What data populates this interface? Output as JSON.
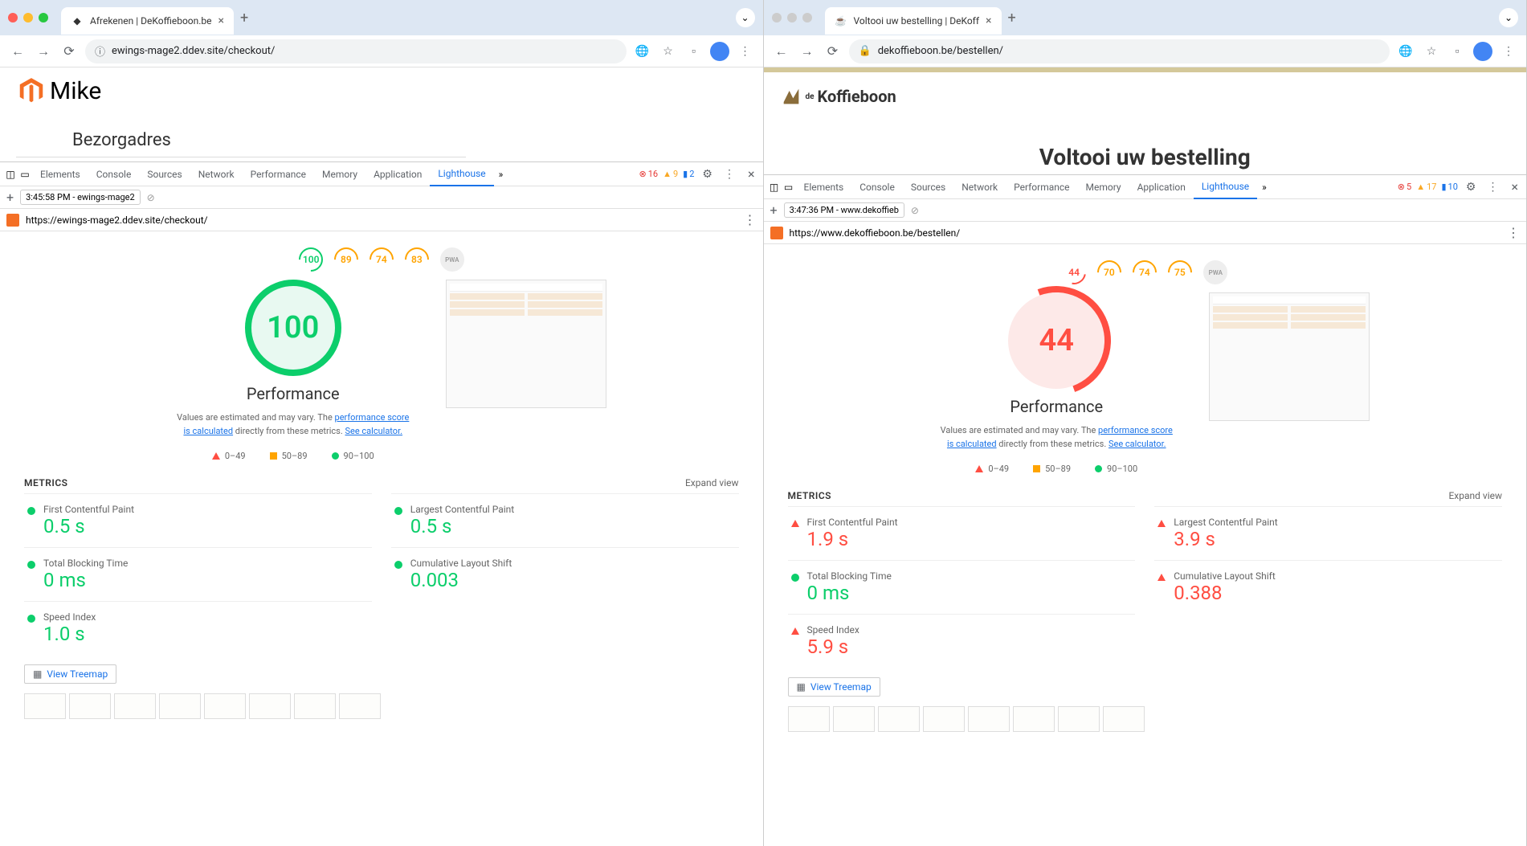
{
  "left": {
    "tab_title": "Afrekenen | DeKoffieboon.be",
    "url": "ewings-mage2.ddev.site/checkout/",
    "logo_text": "Mike",
    "heading": "Bezorgadres",
    "devtools_tabs": [
      "Elements",
      "Console",
      "Sources",
      "Network",
      "Performance",
      "Memory",
      "Application",
      "Lighthouse"
    ],
    "errors": "16",
    "warnings": "9",
    "info": "2",
    "timestamp": "3:45:58 PM - ewings-mage2",
    "report_url": "https://ewings-mage2.ddev.site/checkout/",
    "pills": [
      "100",
      "89",
      "74",
      "83",
      "PWA"
    ],
    "gauge": "100",
    "perf_title": "Performance",
    "note_prefix": "Values are estimated and may vary. The ",
    "note_link1": "performance score is calculated",
    "note_mid": " directly from these metrics. ",
    "note_link2": "See calculator.",
    "legend": {
      "r": "0–49",
      "o": "50–89",
      "g": "90–100"
    },
    "metrics_label": "METRICS",
    "expand": "Expand view",
    "metrics": [
      {
        "name": "First Contentful Paint",
        "value": "0.5 s",
        "status": "green"
      },
      {
        "name": "Largest Contentful Paint",
        "value": "0.5 s",
        "status": "green"
      },
      {
        "name": "Total Blocking Time",
        "value": "0 ms",
        "status": "green"
      },
      {
        "name": "Cumulative Layout Shift",
        "value": "0.003",
        "status": "green"
      },
      {
        "name": "Speed Index",
        "value": "1.0 s",
        "status": "green"
      }
    ],
    "view_treemap": "View Treemap"
  },
  "right": {
    "tab_title": "Voltooi uw bestelling | DeKoff",
    "url": "dekoffieboon.be/bestellen/",
    "logo_text": "Koffieboon",
    "heading": "Voltooi uw bestelling",
    "devtools_tabs": [
      "Elements",
      "Console",
      "Sources",
      "Network",
      "Performance",
      "Memory",
      "Application",
      "Lighthouse"
    ],
    "errors": "5",
    "warnings": "17",
    "info": "10",
    "timestamp": "3:47:36 PM - www.dekoffieb",
    "report_url": "https://www.dekoffieboon.be/bestellen/",
    "pills": [
      "44",
      "70",
      "74",
      "75",
      "PWA"
    ],
    "gauge": "44",
    "perf_title": "Performance",
    "note_prefix": "Values are estimated and may vary. The ",
    "note_link1": "performance score is calculated",
    "note_mid": " directly from these metrics. ",
    "note_link2": "See calculator.",
    "legend": {
      "r": "0–49",
      "o": "50–89",
      "g": "90–100"
    },
    "metrics_label": "METRICS",
    "expand": "Expand view",
    "metrics": [
      {
        "name": "First Contentful Paint",
        "value": "1.9 s",
        "status": "red"
      },
      {
        "name": "Largest Contentful Paint",
        "value": "3.9 s",
        "status": "red"
      },
      {
        "name": "Total Blocking Time",
        "value": "0 ms",
        "status": "green"
      },
      {
        "name": "Cumulative Layout Shift",
        "value": "0.388",
        "status": "red"
      },
      {
        "name": "Speed Index",
        "value": "5.9 s",
        "status": "red"
      }
    ],
    "view_treemap": "View Treemap"
  },
  "chart_data": [
    {
      "type": "gauge",
      "title": "Performance",
      "value": 100,
      "range": [
        0,
        100
      ],
      "window": "left"
    },
    {
      "type": "gauge",
      "title": "Performance",
      "value": 44,
      "range": [
        0,
        100
      ],
      "window": "right"
    }
  ]
}
